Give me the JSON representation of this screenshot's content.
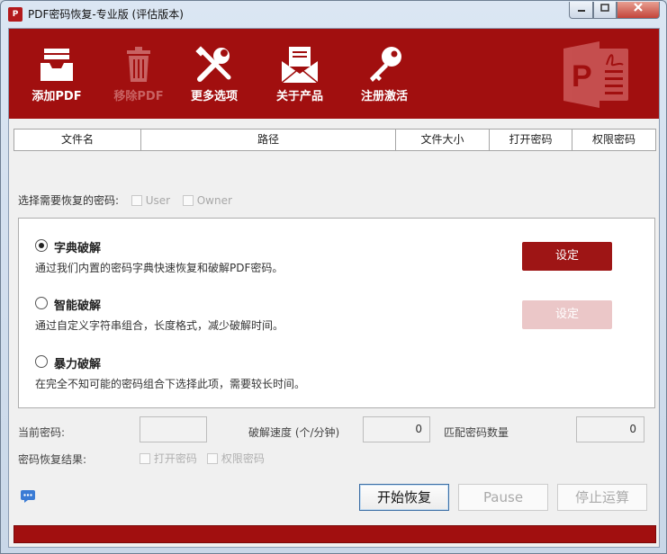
{
  "window": {
    "title": "PDF密码恢复-专业版 (评估版本)",
    "app_icon_text": "P",
    "minimize_icon": "minimize-icon",
    "maximize_icon": "maximize-icon",
    "close_icon": "close-icon"
  },
  "toolbar": {
    "items": [
      {
        "label": "添加PDF",
        "icon": "tray-add-icon",
        "enabled": true
      },
      {
        "label": "移除PDF",
        "icon": "trash-icon",
        "enabled": false
      },
      {
        "label": "更多选项",
        "icon": "tools-icon",
        "enabled": true
      },
      {
        "label": "关于产品",
        "icon": "envelope-icon",
        "enabled": true
      },
      {
        "label": "注册激活",
        "icon": "key-icon",
        "enabled": true
      }
    ],
    "brand_logo": "pdf-logo"
  },
  "table": {
    "columns": [
      "文件名",
      "路径",
      "文件大小",
      "打开密码",
      "权限密码"
    ]
  },
  "password_select": {
    "label": "选择需要恢复的密码:",
    "options": [
      {
        "label": "User",
        "checked": false
      },
      {
        "label": "Owner",
        "checked": false
      }
    ]
  },
  "methods": [
    {
      "title": "字典破解",
      "desc": "通过我们内置的密码字典快速恢复和破解PDF密码。",
      "selected": true,
      "button": "设定",
      "button_enabled": true
    },
    {
      "title": "智能破解",
      "desc": "通过自定义字符串组合，长度格式，减少破解时间。",
      "selected": false,
      "button": "设定",
      "button_enabled": false
    },
    {
      "title": "暴力破解",
      "desc": "在完全不知可能的密码组合下选择此项，需要较长时间。",
      "selected": false
    }
  ],
  "stats": {
    "current_password_label": "当前密码:",
    "current_password_value": "",
    "speed_label": "破解速度 (个/分钟)",
    "speed_value": "0",
    "match_label": "匹配密码数量",
    "match_value": "0"
  },
  "result": {
    "label": "密码恢复结果:",
    "options": [
      "打开密码",
      "权限密码"
    ]
  },
  "actions": {
    "start": "开始恢复",
    "pause": "Pause",
    "stop": "停止运算"
  },
  "progress": {
    "value": 1.0
  },
  "colors": {
    "brand": "#a10f0f",
    "button_active": "#9e1515",
    "button_disabled": "#ebc7c8"
  }
}
